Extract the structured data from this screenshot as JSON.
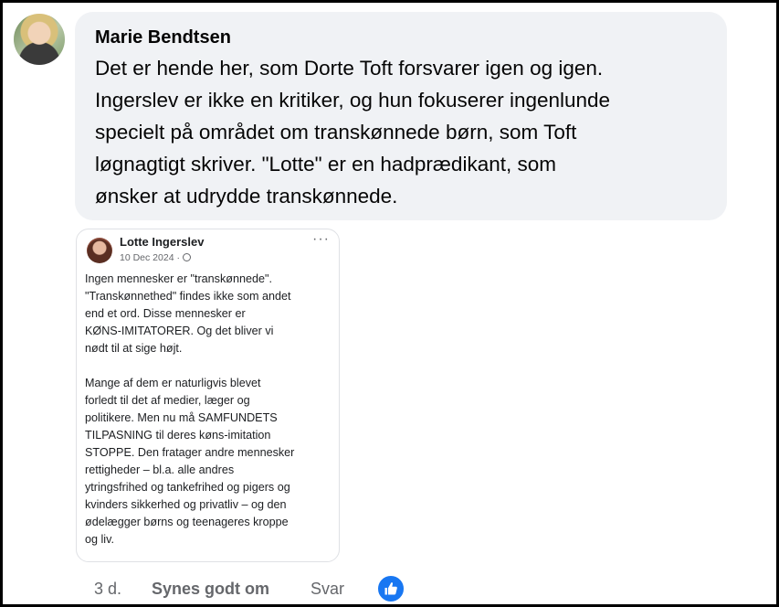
{
  "comment": {
    "author": "Marie Bendtsen",
    "text": "Det er hende her, som Dorte Toft forsvarer igen og igen. Ingerslev er ikke en kritiker, og hun fokuserer ingenlunde specielt på området om transkønnede børn, som Toft løgnagtigt skriver. \"Lotte\" er en hadprædikant, som ønsker at udrydde transkønnede.",
    "lines": [
      "Det er hende her, som Dorte Toft forsvarer igen og igen.",
      "Ingerslev er ikke en kritiker, og hun fokuserer ingenlunde",
      "specielt på området om transkønnede børn, som Toft",
      "løgnagtigt skriver. \"Lotte\" er en hadprædikant, som",
      "ønsker at udrydde transkønnede."
    ]
  },
  "attachment": {
    "author": "Lotte Ingerslev",
    "date": "10 Dec 2024 ·",
    "more": "···",
    "paragraph1": [
      "Ingen mennesker er \"transkønnede\".",
      "\"Transkønnethed\" findes ikke som andet",
      "end et ord. Disse mennesker er",
      "KØNS-IMITATORER. Og det bliver vi",
      "nødt til at sige højt."
    ],
    "paragraph2": [
      "Mange af dem er naturligvis blevet",
      "forledt til det af medier, læger og",
      "politikere. Men nu må SAMFUNDETS",
      "TILPASNING til deres køns-imitation",
      "STOPPE. Den fratager andre mennesker",
      "rettigheder – bl.a. alle andres",
      "ytringsfrihed og tankefrihed og pigers og",
      "kvinders sikkerhed og privatliv – og den",
      "ødelægger børns og teenageres kroppe",
      "og liv."
    ]
  },
  "actions": {
    "time": "3 d.",
    "like": "Synes godt om",
    "reply": "Svar"
  },
  "icons": {
    "like_badge": "thumbs-up-icon",
    "privacy": "globe-icon"
  },
  "colors": {
    "bubble": "#f0f2f5",
    "like_blue": "#1877f2",
    "meta_text": "#65676b"
  }
}
